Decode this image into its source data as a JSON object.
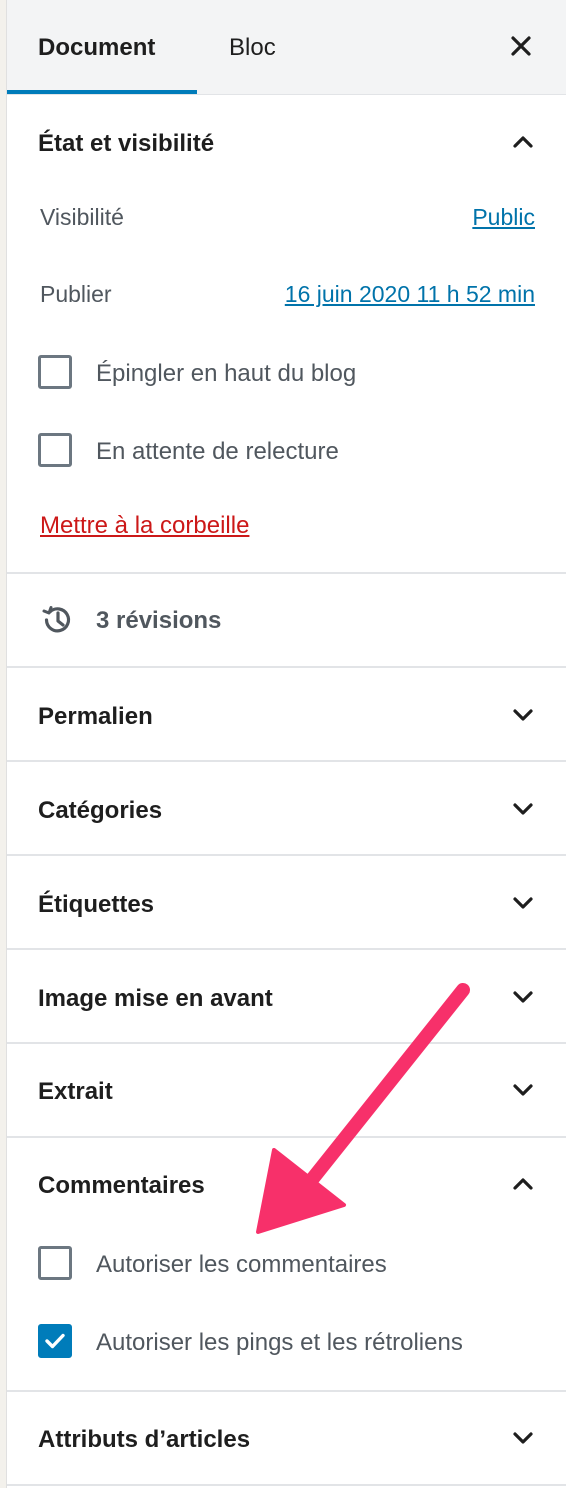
{
  "tabs": {
    "document_label": "Document",
    "bloc_label": "Bloc",
    "close_icon": "close-icon"
  },
  "status_section": {
    "title": "État et visibilité",
    "expanded": true,
    "visibility_label": "Visibilité",
    "visibility_value": "Public",
    "publish_label": "Publier",
    "publish_value": "16 juin 2020 11 h 52 min",
    "sticky_label": "Épingler en haut du blog",
    "sticky_checked": false,
    "pending_label": "En attente de relecture",
    "pending_checked": false,
    "trash_label": "Mettre à la corbeille"
  },
  "revisions": {
    "label": "3 révisions",
    "icon": "history-icon"
  },
  "collapsed_sections": {
    "permalink": "Permalien",
    "categories": "Catégories",
    "tags": "Étiquettes",
    "featured_image": "Image mise en avant",
    "excerpt": "Extrait"
  },
  "comments_section": {
    "title": "Commentaires",
    "expanded": true,
    "allow_comments_label": "Autoriser les commentaires",
    "allow_comments_checked": false,
    "allow_pings_label": "Autoriser les pings et les rétroliens",
    "allow_pings_checked": true
  },
  "attributes_section": {
    "title": "Attributs d’articles"
  },
  "colors": {
    "accent": "#007cba",
    "link": "#0073aa",
    "danger": "#cc1818",
    "annotation_arrow": "#f7306a"
  }
}
